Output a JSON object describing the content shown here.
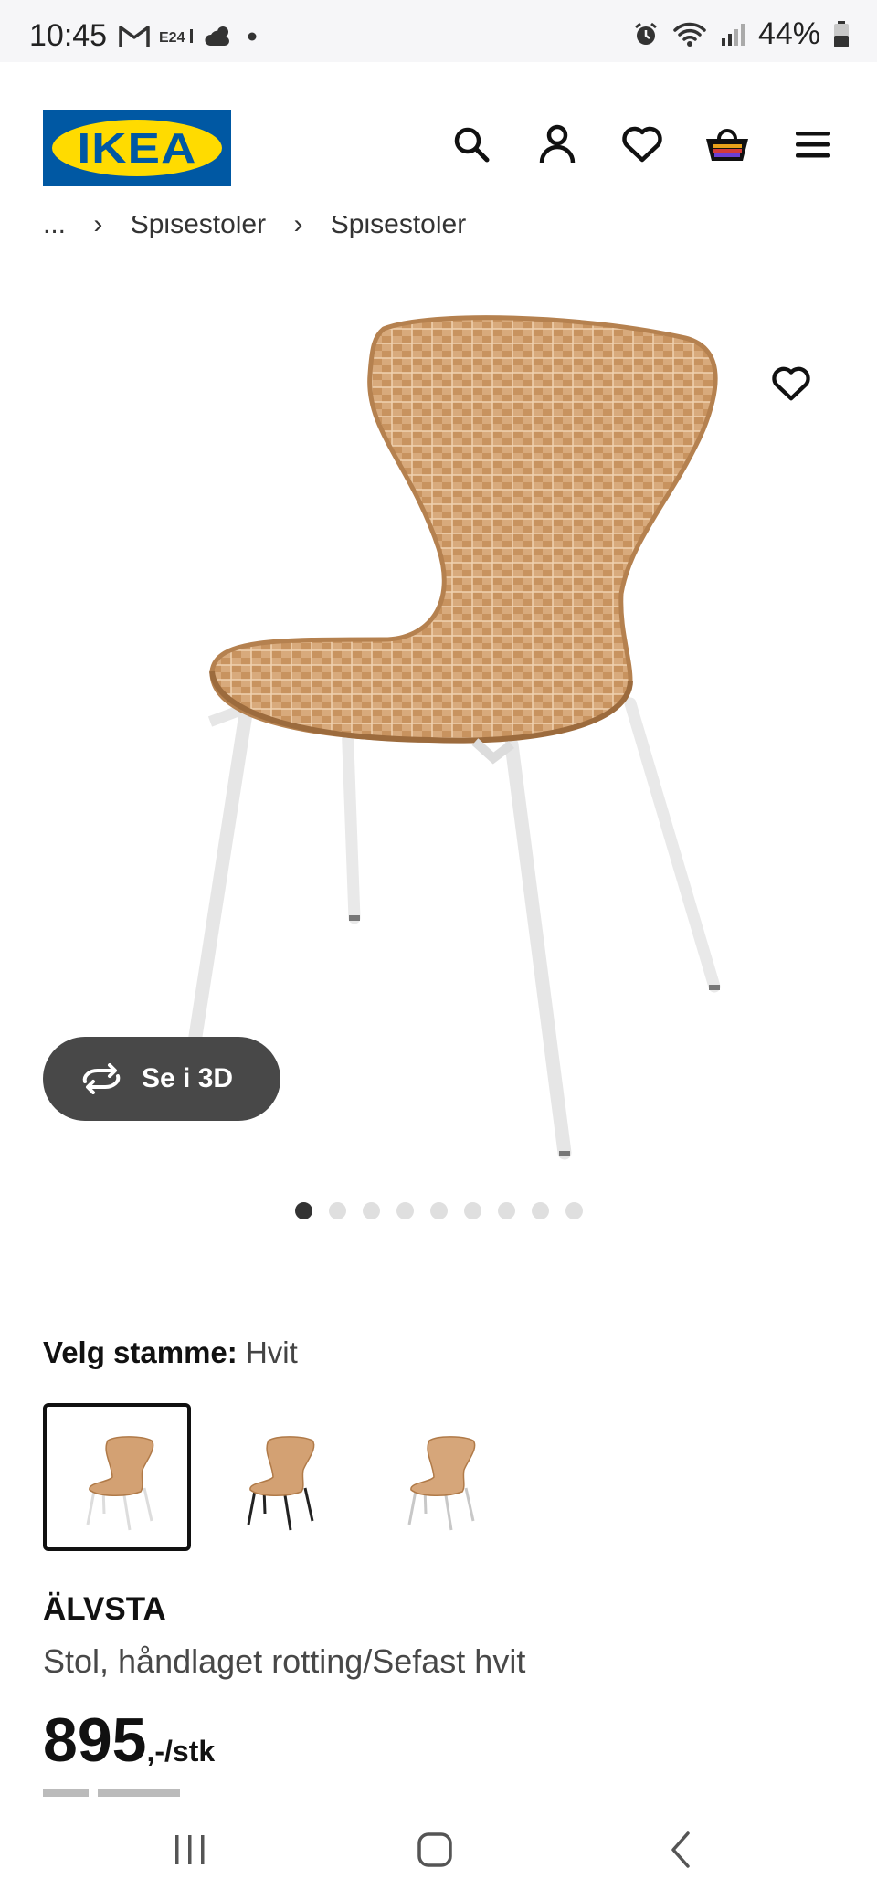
{
  "status_bar": {
    "time": "10:45",
    "left_icons": [
      "gmail-icon",
      "e24-icon",
      "weather-icon",
      "dot-icon"
    ],
    "right_icons": [
      "alarm-icon",
      "wifi-icon",
      "signal-icon",
      "battery-icon"
    ],
    "battery": "44%"
  },
  "header": {
    "logo_text": "IKEA",
    "icons": [
      "search-icon",
      "account-icon",
      "favorites-heart-icon",
      "cart-basket-icon",
      "menu-icon"
    ]
  },
  "breadcrumb": [
    "...",
    "Spisestoler",
    "Spisestoler"
  ],
  "gallery": {
    "view_3d_label": "Se i 3D",
    "dot_count": 9,
    "active_dot": 0
  },
  "variant": {
    "label": "Velg stamme:",
    "value": "Hvit",
    "options": [
      "Hvit",
      "Svart",
      "Hvit-grå"
    ]
  },
  "product": {
    "name": "ÄLVSTA",
    "description": "Stol, håndlaget rotting/Sefast hvit",
    "price": "895",
    "price_unit": ",-/stk"
  },
  "colors": {
    "ikea_blue": "#0058a3",
    "ikea_yellow": "#ffdb00",
    "button_3d_bg": "#484848"
  }
}
